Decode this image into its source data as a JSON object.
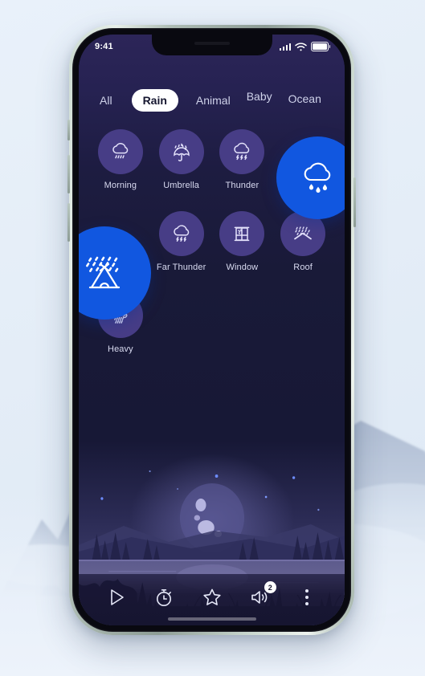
{
  "status_bar": {
    "time": "9:41",
    "signal_icon": "signal-bars-icon",
    "wifi_icon": "wifi-icon",
    "battery_icon": "battery-icon"
  },
  "tabs": [
    {
      "label": "All",
      "active": false
    },
    {
      "label": "Rain",
      "active": true
    },
    {
      "label": "Animal",
      "active": false
    },
    {
      "label": "Baby",
      "active": false
    },
    {
      "label": "Ocean",
      "active": false
    }
  ],
  "sounds": [
    {
      "label": "Morning",
      "icon": "cloud-rain-icon"
    },
    {
      "label": "Umbrella",
      "icon": "umbrella-rain-icon"
    },
    {
      "label": "Thunder",
      "icon": "cloud-lightning-icon"
    },
    {
      "label": "Far Thunder",
      "icon": "cloud-lightning-icon"
    },
    {
      "label": "Window",
      "icon": "window-rain-icon"
    },
    {
      "label": "Roof",
      "icon": "roof-rain-icon"
    },
    {
      "label": "Heavy",
      "icon": "heavy-rain-cloud-icon"
    }
  ],
  "highlighted": [
    {
      "name": "rain-cloud-highlight",
      "icon": "cloud-raindrops-icon"
    },
    {
      "name": "tent-rain-highlight",
      "icon": "tent-rain-icon"
    }
  ],
  "toolbar": {
    "play_label": "play-icon",
    "timer_label": "timer-icon",
    "favorite_label": "star-icon",
    "volume_label": "speaker-icon",
    "volume_badge": "2",
    "menu_label": "more-options-icon"
  },
  "colors": {
    "accent_blue": "#1157e0",
    "disc_purple": "#473d86",
    "app_background": "#171836",
    "page_background": "#e8f0f8",
    "tab_active_bg": "#ffffff"
  }
}
